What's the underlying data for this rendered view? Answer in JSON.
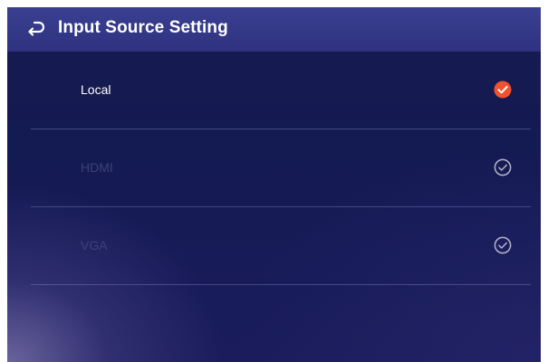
{
  "header": {
    "title": "Input Source Setting",
    "back_icon": "back-arrow-icon"
  },
  "sources": [
    {
      "label": "Local",
      "selected": true
    },
    {
      "label": "HDMI",
      "selected": false
    },
    {
      "label": "VGA",
      "selected": false
    }
  ],
  "colors": {
    "background": "#151a50",
    "header": "#33378a",
    "selected_check": "#f0522e",
    "unselected_check": "#b4b6c8",
    "inactive_text": "#3d4178",
    "divider": "#5a5e9a"
  }
}
